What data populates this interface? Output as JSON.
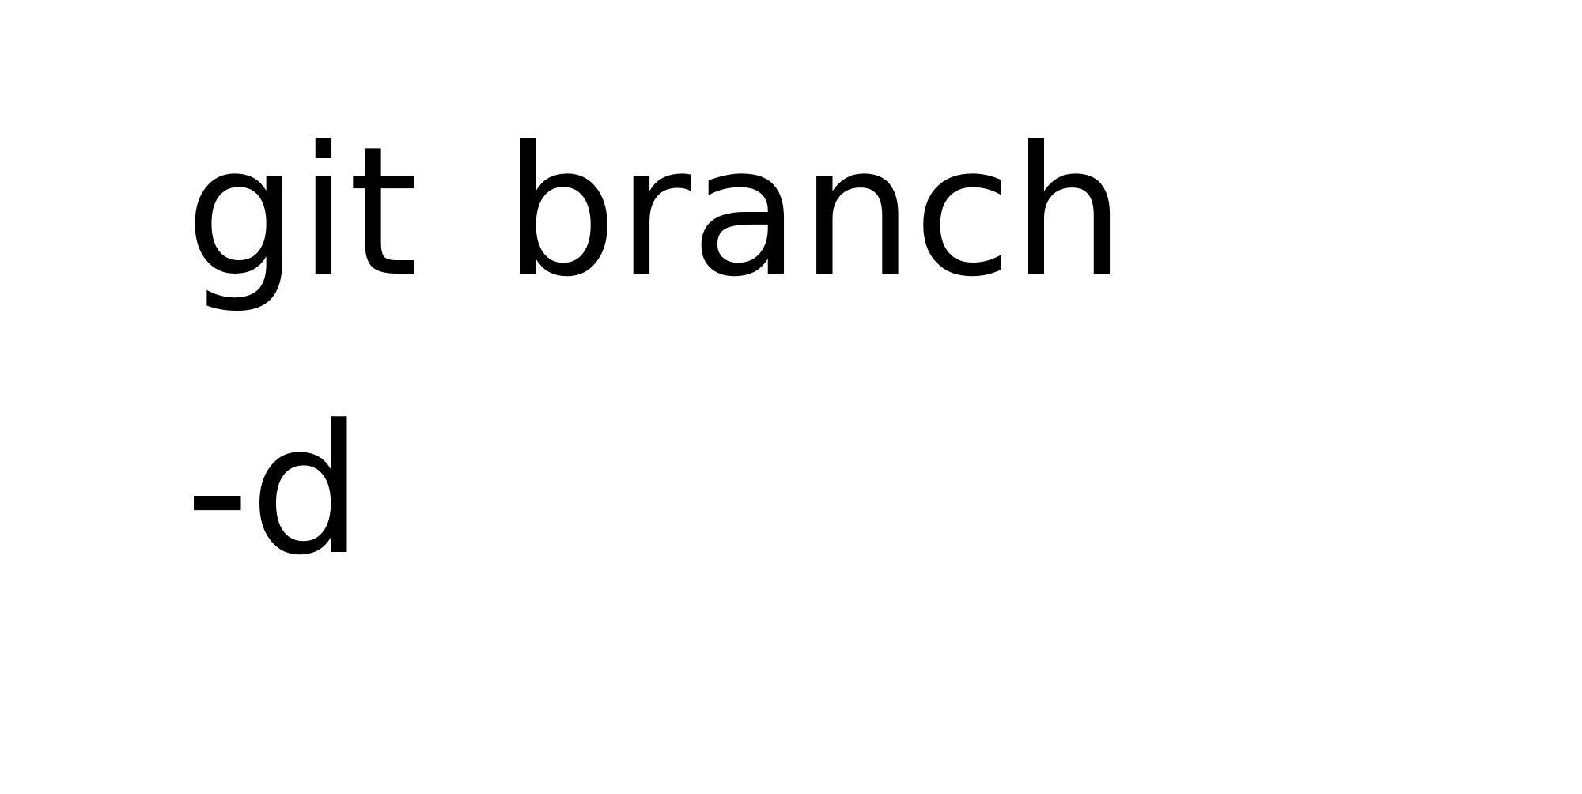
{
  "slide": {
    "lines": [
      "git branch",
      "-d"
    ],
    "text_color": "#000000",
    "background_color": "#ffffff"
  }
}
